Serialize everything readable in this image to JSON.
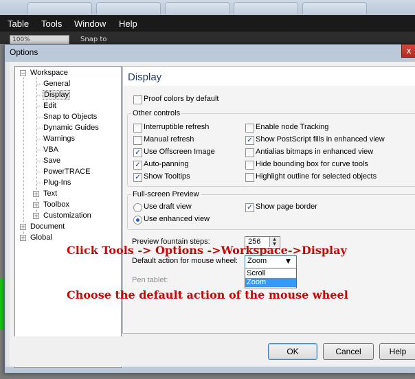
{
  "menubar": {
    "items": [
      "Table",
      "Tools",
      "Window",
      "Help"
    ]
  },
  "toolbar": {
    "zoom": "100%",
    "snap_label": "Snap to"
  },
  "dialog": {
    "title": "Options",
    "close": "x",
    "tree": {
      "items": [
        {
          "label": "Workspace",
          "level": 0,
          "expander": "−"
        },
        {
          "label": "General",
          "level": 1
        },
        {
          "label": "Display",
          "level": 1,
          "selected": true
        },
        {
          "label": "Edit",
          "level": 1
        },
        {
          "label": "Snap to Objects",
          "level": 1
        },
        {
          "label": "Dynamic Guides",
          "level": 1
        },
        {
          "label": "Warnings",
          "level": 1
        },
        {
          "label": "VBA",
          "level": 1
        },
        {
          "label": "Save",
          "level": 1
        },
        {
          "label": "PowerTRACE",
          "level": 1
        },
        {
          "label": "Plug-Ins",
          "level": 1
        },
        {
          "label": "Text",
          "level": 1,
          "expander": "+"
        },
        {
          "label": "Toolbox",
          "level": 1,
          "expander": "+"
        },
        {
          "label": "Customization",
          "level": 1,
          "expander": "+"
        },
        {
          "label": "Document",
          "level": 0,
          "expander": "+"
        },
        {
          "label": "Global",
          "level": 0,
          "expander": "+"
        }
      ]
    },
    "panel": {
      "title": "Display",
      "proof_colors": {
        "label": "Proof colors by default",
        "checked": false
      },
      "other_controls": {
        "label": "Other controls",
        "left": [
          {
            "label": "Interruptible refresh",
            "checked": false
          },
          {
            "label": "Manual refresh",
            "checked": false
          },
          {
            "label": "Use Offscreen Image",
            "checked": true
          },
          {
            "label": "Auto-panning",
            "checked": true
          },
          {
            "label": "Show Tooltips",
            "checked": true
          }
        ],
        "right": [
          {
            "label": "Enable node Tracking",
            "checked": false
          },
          {
            "label": "Show PostScript fills in enhanced view",
            "checked": true
          },
          {
            "label": "Antialias bitmaps in enhanced view",
            "checked": false
          },
          {
            "label": "Hide bounding box for curve tools",
            "checked": false
          },
          {
            "label": "Highlight outline for selected objects",
            "checked": false
          }
        ]
      },
      "fullscreen": {
        "label": "Full-screen Preview",
        "draft": {
          "label": "Use draft view",
          "selected": false
        },
        "enhanced": {
          "label": "Use enhanced view",
          "selected": true
        },
        "page_border": {
          "label": "Show page border",
          "checked": true
        }
      },
      "fountain_steps": {
        "label": "Preview fountain steps:",
        "value": "256"
      },
      "mouse_wheel": {
        "label": "Default action for mouse wheel:",
        "value": "Zoom",
        "options": [
          "Scroll",
          "Zoom"
        ]
      },
      "pen_tablet": {
        "label": "Pen tablet:"
      }
    },
    "buttons": {
      "ok": "OK",
      "cancel": "Cancel",
      "help": "Help"
    }
  },
  "annotations": {
    "line1": "Click Tools -> Options ->Workspace->Display",
    "line2": "Choose the default action of the mouse wheel"
  },
  "colors": {
    "annotation": "#d20000",
    "selection": "#3399ff",
    "panel_title": "#1e3a6e"
  }
}
